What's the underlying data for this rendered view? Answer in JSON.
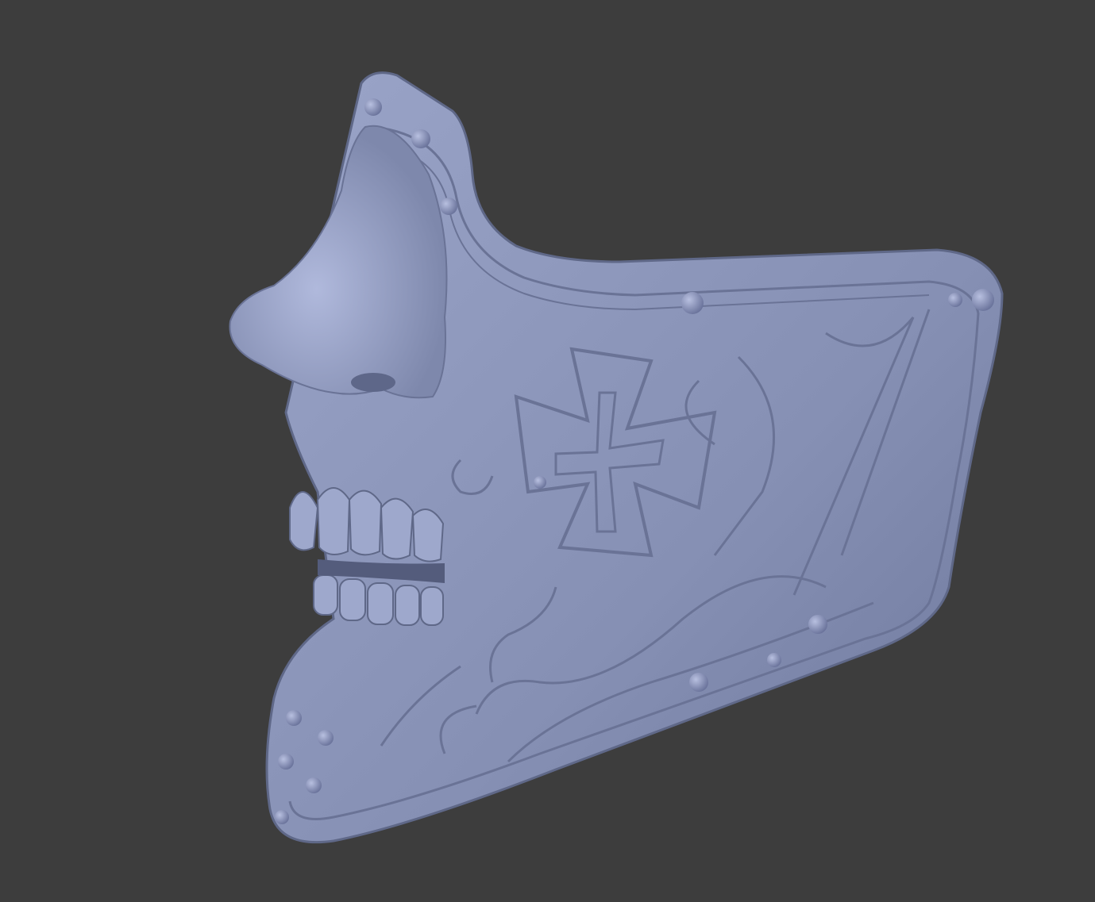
{
  "viewport": {
    "background": "#3d3d3d"
  },
  "model": {
    "base_color": "#8b95b8",
    "highlight_color": "#a4aed0",
    "shadow_color": "#5f6888",
    "line_color": "#6a7396"
  }
}
